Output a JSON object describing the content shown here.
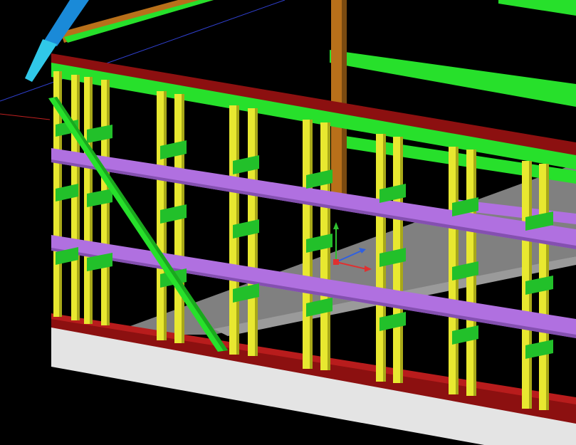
{
  "viewport": {
    "background": "#000000",
    "view": "3d-perspective",
    "content": "timber-frame-wall-model"
  },
  "colors": {
    "background": "#000000",
    "foundation_face": "#e4e4e4",
    "foundation_top": "#c8c8c8",
    "slab": "#808080",
    "slab_light": "#9a9a9a",
    "sill_plate": "#8c1010",
    "sill_plate_top": "#b81c1c",
    "top_plate": "#27e02b",
    "top_plate_side": "#1aa81e",
    "stud": "#e8e830",
    "stud_shade": "#a8a818",
    "blocking": "#22c02a",
    "girt": "#b070e0",
    "girt_shade": "#8450b0",
    "post": "#b8701a",
    "post_shade": "#7a4a10",
    "roof_member_blue": "#1a8ad8",
    "roof_member_cyan": "#30c8e8",
    "axis_x": "#e03030",
    "axis_y": "#30c030",
    "axis_z": "#3060e0",
    "construction_line_blue": "#3040d0",
    "construction_line_red": "#c02020"
  },
  "icons": {
    "ucs": "ucs-axis-icon"
  }
}
